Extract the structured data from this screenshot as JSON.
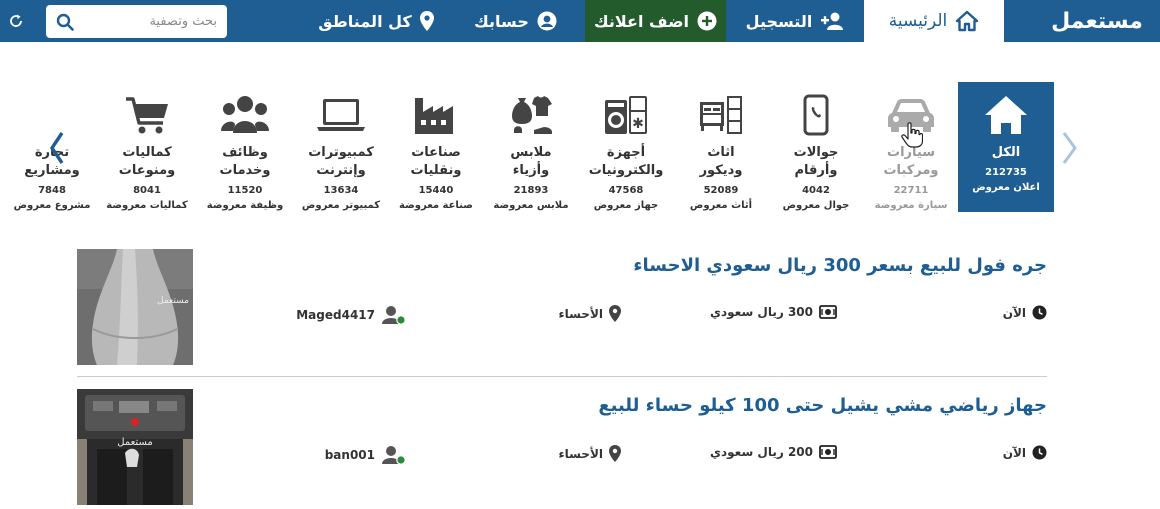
{
  "nav": {
    "logo": "مستعمل",
    "home": "الرئيسية",
    "register": "التسجيل",
    "add_ad": "اضف اعلانك",
    "account": "حسابك",
    "regions": "كل المناطق",
    "search_placeholder": "بحث وتصفية",
    "colors": {
      "bar": "#1f5e92",
      "add_ad": "#245b2c"
    }
  },
  "categories": [
    {
      "name": "الكل",
      "count": "212735",
      "label": "اعلان معروض",
      "icon": "home-icon"
    },
    {
      "name": "سيارات\nومركبات",
      "count": "22711",
      "label": "سيارة معروضة",
      "icon": "car-icon"
    },
    {
      "name": "جوالات\nوأرقام",
      "count": "4042",
      "label": "جوال معروض",
      "icon": "mobile-icon"
    },
    {
      "name": "اثاث\nوديكور",
      "count": "52089",
      "label": "أثاث معروض",
      "icon": "furniture-icon"
    },
    {
      "name": "أجهزة\nوالكترونيات",
      "count": "47568",
      "label": "جهاز معروض",
      "icon": "appliances-icon"
    },
    {
      "name": "ملابس\nوأزياء",
      "count": "21893",
      "label": "ملابس معروضة",
      "icon": "clothes-icon"
    },
    {
      "name": "صناعات\nونقليات",
      "count": "15440",
      "label": "صناعة معروضة",
      "icon": "factory-icon"
    },
    {
      "name": "كمبيوترات\nوإنترنت",
      "count": "13634",
      "label": "كمبيوتر معروض",
      "icon": "laptop-icon"
    },
    {
      "name": "وظائف\nوخدمات",
      "count": "11520",
      "label": "وظيفة معروضة",
      "icon": "people-icon"
    },
    {
      "name": "كماليات\nومنوعات",
      "count": "8041",
      "label": "كماليات معروضة",
      "icon": "cart-icon"
    },
    {
      "name": "تجارة\nومشاريع",
      "count": "7848",
      "label": "مشروع معروض",
      "icon": "money-growth-icon"
    }
  ],
  "listings": [
    {
      "title": "جره فول للبيع بسعر 300 ريال سعودي الاحساء",
      "time": "الآن",
      "price": "300 ريال سعودي",
      "location": "الأحساء",
      "user": "Maged4417",
      "watermark": "مستعمل"
    },
    {
      "title": "جهاز رياضي مشي يشيل حتى 100 كيلو حساء للبيع",
      "time": "الآن",
      "price": "200 ريال سعودي",
      "location": "الأحساء",
      "user": "ban001",
      "watermark": "مستعمل"
    }
  ]
}
